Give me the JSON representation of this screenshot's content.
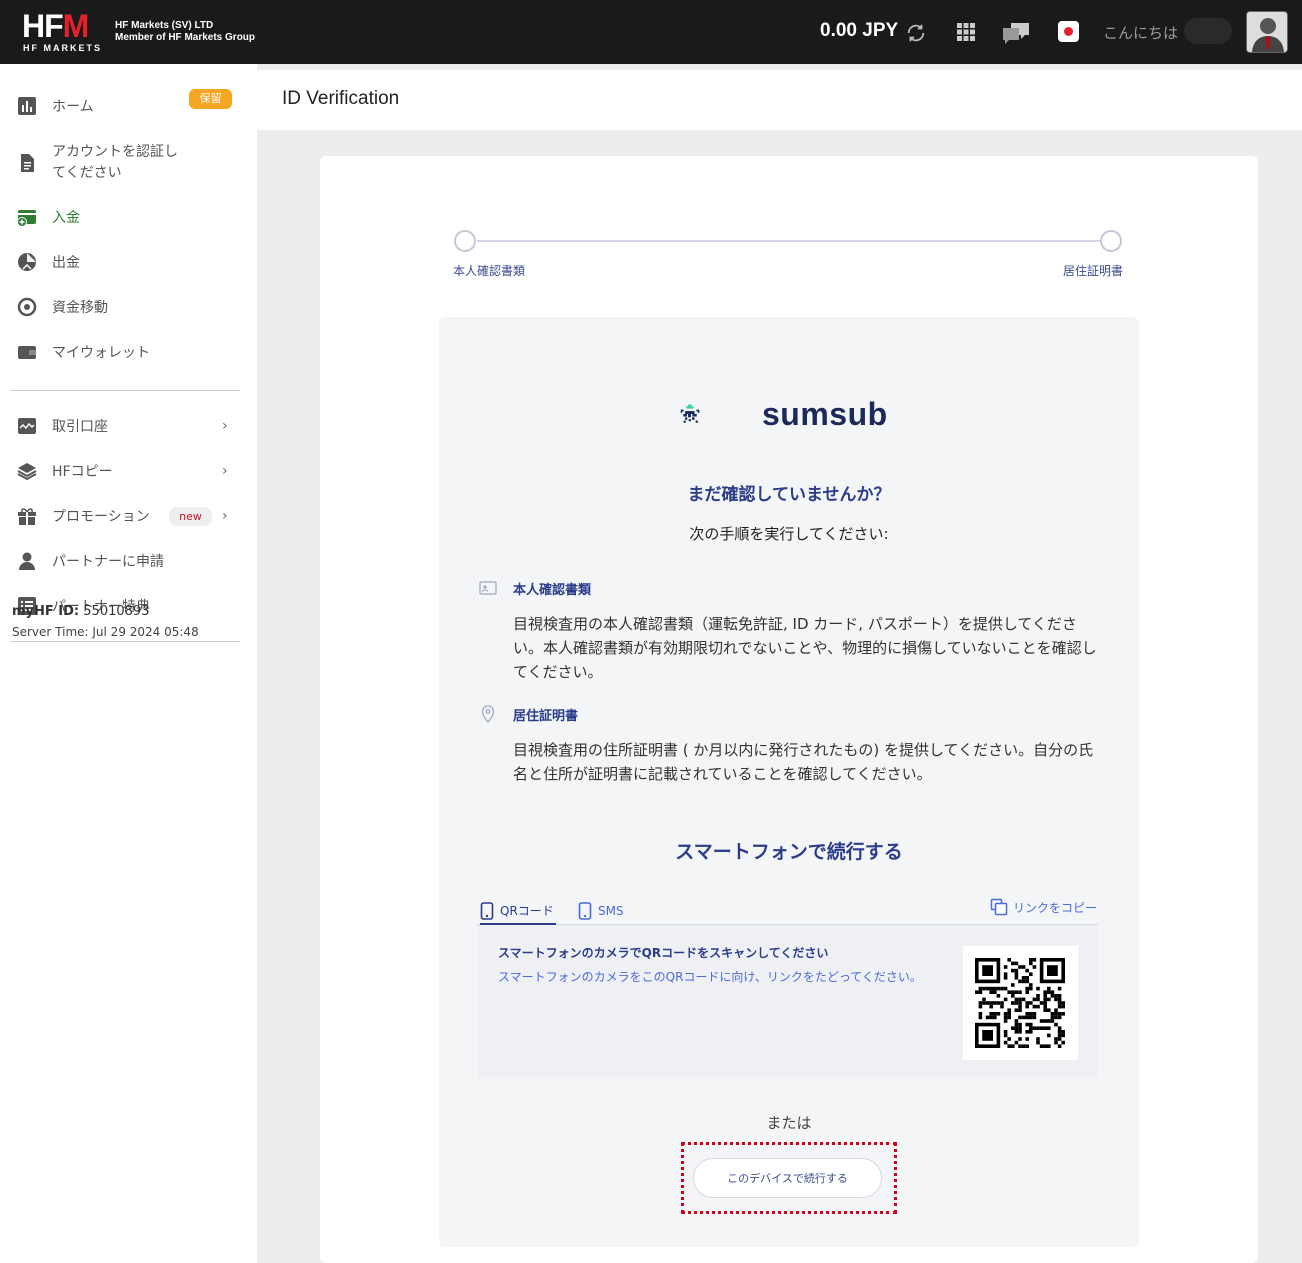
{
  "header": {
    "logo_main": "HFM",
    "logo_sub": "HF MARKETS",
    "company_line1": "HF Markets (SV) LTD",
    "company_line2": "Member of HF Markets Group",
    "balance": "0.00 JPY",
    "greeting": "こんにちは",
    "icons": [
      "refresh-icon",
      "apps-grid-icon",
      "chat-icon",
      "flag-icon",
      "avatar"
    ]
  },
  "sidebar": {
    "items": [
      {
        "label": "ホーム",
        "icon": "bar-chart-icon"
      },
      {
        "label_line1": "アカウントを認証し",
        "label_line2": "てください",
        "icon": "document-icon",
        "badge": "保留"
      },
      {
        "label": "入金",
        "icon": "deposit-icon",
        "active": true
      },
      {
        "label": "出金",
        "icon": "withdraw-icon"
      },
      {
        "label": "資金移動",
        "icon": "transfer-icon"
      },
      {
        "label": "マイウォレット",
        "icon": "wallet-icon"
      },
      {
        "label": "取引口座",
        "icon": "trading-chart-icon"
      },
      {
        "label": "HFコピー",
        "icon": "layers-icon"
      },
      {
        "label": "プロモーション",
        "icon": "gift-icon",
        "badge": "new"
      },
      {
        "label": "パートナーに申請",
        "icon": "person-icon"
      },
      {
        "label": "パートナー特典",
        "icon": "list-icon"
      }
    ],
    "myhf_label": "myHF ID:",
    "myhf_id": "55010893",
    "server_time": "Server Time: Jul 29 2024 05:48",
    "active_color": "#2e7d32"
  },
  "main": {
    "page_title": "ID Verification",
    "steps": [
      "本人確認書類",
      "居住証明書"
    ],
    "brand": "sumsub",
    "not_verified_heading": "まだ確認していませんか？",
    "instructions": "次の手順を実行してください:",
    "sections": [
      {
        "title": "本人確認書類",
        "icon": "id-card-icon",
        "body": "目視検査用の本人確認書類（運転免許証, ID カード, パスポート）を提供してください。本人確認書類が有効期限切れでないことや、物理的に損傷していないことを確認してください。"
      },
      {
        "title": "居住証明書",
        "icon": "location-pin-icon",
        "body": "目視検査用の住所証明書 ( か月以内に発行されたもの) を提供してください。自分の氏名と住所が証明書に記載されていることを確認してください。"
      }
    ],
    "smartphone_heading": "スマートフォンで続行する",
    "tabs": [
      {
        "label": "QRコード",
        "icon": "phone-icon",
        "active": true
      },
      {
        "label": "SMS",
        "icon": "phone-icon",
        "active": false
      }
    ],
    "copy_link": "リンクをコピー",
    "qr_title": "スマートフォンのカメラでQRコードをスキャンしてください",
    "qr_desc": "スマートフォンのカメラをこのQRコードに向け、リンクをたどってください。",
    "or_text": "または",
    "continue_device_button": "このデバイスで続行する",
    "accent_color": "#2a3c8a",
    "highlight_color": "#d0021b"
  }
}
